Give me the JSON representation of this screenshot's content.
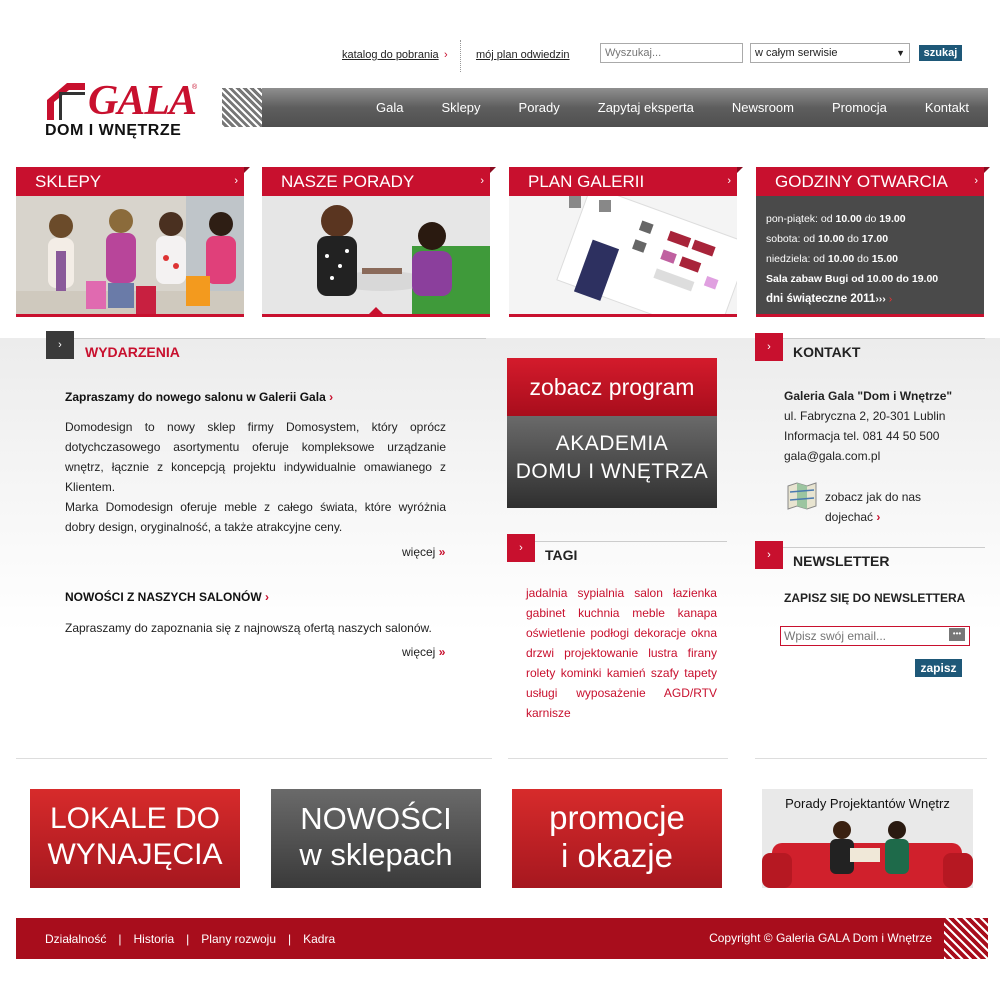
{
  "utility": {
    "catalog_link": "katalog do pobrania",
    "plan_link": "mój plan odwiedzin",
    "search_placeholder": "Wyszukaj...",
    "search_scope": "w całym serwisie",
    "search_button": "szukaj"
  },
  "logo": {
    "name": "GALA",
    "subtitle": "DOM I WNĘTRZE",
    "reg": "®"
  },
  "nav": [
    "Gala",
    "Sklepy",
    "Porady",
    "Zapytaj eksperta",
    "Newsroom",
    "Promocja",
    "Kontakt"
  ],
  "features": {
    "sklepy": "SKLEPY",
    "porady": "NASZE PORADY",
    "plan": "PLAN GALERII",
    "godziny": "GODZINY OTWARCIA"
  },
  "hours": {
    "weekday_label": "pon-piątek:",
    "weekday_from": "10.00",
    "weekday_to": "19.00",
    "sat_label": "sobota:",
    "sat_from": "10.00",
    "sat_to": "17.00",
    "sun_label": "niedziela:",
    "sun_from": "10.00",
    "sun_to": "15.00",
    "od": "od",
    "do": "do",
    "bugi": "Sala zabaw Bugi od 10.00 do 19.00",
    "holidays": "dni świąteczne 2011"
  },
  "events": {
    "title": "WYDARZENIA",
    "article1_title": "Zapraszamy do nowego salonu w Galerii Gala",
    "article1_p1": "Domodesign to nowy sklep firmy Domosystem, który oprócz dotychczasowego asortymentu oferuje kompleksowe urządzanie wnętrz, łącznie z koncepcją projektu indywidualnie omawianego z Klientem.",
    "article1_p2": "Marka Domodesign oferuje meble z całego świata, które wyróżnia dobry design, oryginalność, a także atrakcyjne ceny.",
    "more": "więcej",
    "article2_title": "NOWOŚCI Z NASZYCH SALONÓW",
    "article2_p": "Zapraszamy do zapoznania się z najnowszą ofertą naszych salonów."
  },
  "promo": {
    "top": "zobacz program",
    "bottom_line1": "AKADEMIA",
    "bottom_line2": "DOMU I WNĘTRZA"
  },
  "tags": {
    "title": "TAGI",
    "items": [
      "jadalnia",
      "sypialnia",
      "salon",
      "łazienka",
      "gabinet",
      "kuchnia",
      "meble",
      "kanapa",
      "oświetlenie",
      "podłogi",
      "dekoracje",
      "okna",
      "drzwi",
      "projektowanie",
      "lustra",
      "firany",
      "rolety",
      "kominki",
      "kamień",
      "szafy",
      "tapety",
      "usługi",
      "wyposażenie",
      "AGD/RTV",
      "karnisze"
    ]
  },
  "contact": {
    "title": "KONTAKT",
    "name": "Galeria Gala \"Dom i Wnętrze\"",
    "address": "ul. Fabryczna 2, 20-301 Lublin",
    "phone": "Informacja tel. 081 44 50 500",
    "email": "gala@gala.com.pl",
    "map_line1": "zobacz jak do nas",
    "map_line2": "dojechać"
  },
  "newsletter": {
    "title": "NEWSLETTER",
    "subtitle": "ZAPISZ SIĘ DO NEWSLETTERA",
    "placeholder": "Wpisz swój email...",
    "button": "zapisz"
  },
  "banners": {
    "lokale_1": "LOKALE DO",
    "lokale_2": "WYNAJĘCIA",
    "nowosci_1": "NOWOŚCI",
    "nowosci_2": "w sklepach",
    "promocje_1": "promocje",
    "promocje_2": "i okazje",
    "porady": "Porady Projektantów Wnętrz"
  },
  "footer": {
    "links": [
      "Działalność",
      "Historia",
      "Plany rozwoju",
      "Kadra"
    ],
    "sep": "|",
    "copyright": "Copyright © Galeria GALA Dom i Wnętrze"
  },
  "colors": {
    "brand_red": "#c8102e",
    "button_blue": "#1e5878",
    "dark_gray": "#4a4a4a"
  }
}
